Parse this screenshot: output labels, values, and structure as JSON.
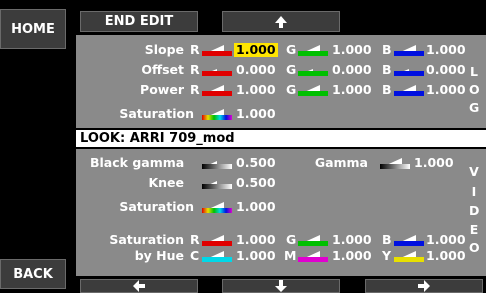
{
  "nav": {
    "home": "HOME",
    "back": "BACK",
    "end_edit": "END EDIT"
  },
  "log": {
    "side_label": [
      "L",
      "O",
      "G"
    ],
    "slope": {
      "label": "Slope",
      "r": "1.000",
      "g": "1.000",
      "b": "1.000"
    },
    "offset": {
      "label": "Offset",
      "r": "0.000",
      "g": "0.000",
      "b": "0.000"
    },
    "power": {
      "label": "Power",
      "r": "1.000",
      "g": "1.000",
      "b": "1.000"
    },
    "saturation": {
      "label": "Saturation",
      "value": "1.000"
    }
  },
  "look": {
    "title": "LOOK: ARRI 709_mod"
  },
  "video": {
    "side_label": [
      "V",
      "I",
      "D",
      "E",
      "O"
    ],
    "black_gamma": {
      "label": "Black gamma",
      "value": "0.500"
    },
    "gamma": {
      "label": "Gamma",
      "value": "1.000"
    },
    "knee": {
      "label": "Knee",
      "value": "0.500"
    },
    "saturation": {
      "label": "Saturation",
      "value": "1.000"
    },
    "sat_by_hue": {
      "label1": "Saturation",
      "label2": "by Hue",
      "r": "1.000",
      "g": "1.000",
      "b": "1.000",
      "c": "1.000",
      "m": "1.000",
      "y": "1.000"
    }
  },
  "channels": {
    "r": "R",
    "g": "G",
    "b": "B",
    "c": "C",
    "m": "M",
    "y": "Y"
  },
  "colors": {
    "red": "#e00000",
    "green": "#00c000",
    "blue": "#0010e0",
    "cyan": "#00d8e8",
    "magenta": "#e000d0",
    "yellow": "#e8e000",
    "highlight": "#ffe600"
  }
}
